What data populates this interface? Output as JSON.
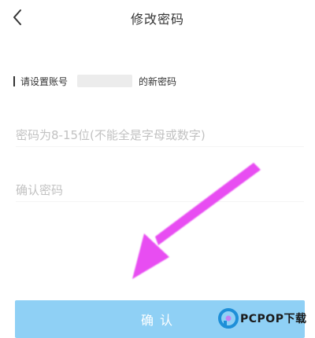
{
  "header": {
    "back_icon": "chevron-left-icon",
    "title": "修改密码"
  },
  "account_hint": {
    "prefix": "请设置账号",
    "suffix": "的新密码"
  },
  "form": {
    "password_placeholder": "密码为8-15位(不能全是字母或数字)",
    "password_value": "",
    "confirm_placeholder": "确认密码",
    "confirm_value": ""
  },
  "confirm_button": {
    "label": "确认",
    "color": "#8fd0f5"
  },
  "annotation": {
    "arrow_color": "#e84df2"
  },
  "watermark": {
    "text": "PCPOP下载"
  }
}
